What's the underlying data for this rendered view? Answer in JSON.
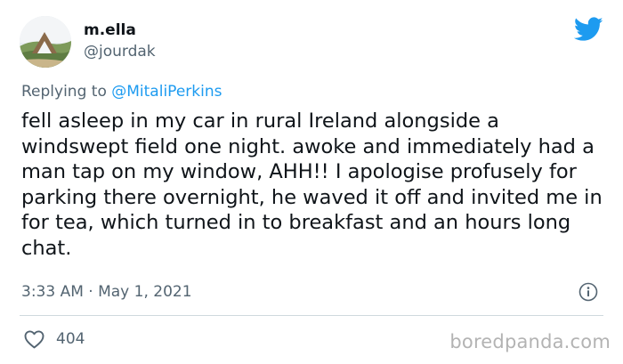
{
  "author": {
    "display_name": "m.ella",
    "handle": "@jourdak",
    "avatar_icon": "landscape-avatar"
  },
  "reply": {
    "prefix": "Replying to ",
    "mention": "@MitaliPerkins"
  },
  "tweet": {
    "text": "fell asleep in my car in rural Ireland alongside a windswept field one night. awoke and immediately had a man tap on my window, AHH!! I apologise profusely for parking there overnight, he waved it off and invited me in for tea, which turned in to breakfast and an hours long chat.",
    "timestamp": "3:33 AM · May 1, 2021"
  },
  "engagement": {
    "likes": "404"
  },
  "watermark": "boredpanda.com",
  "colors": {
    "twitter_blue": "#1d9bf0",
    "secondary_text": "#536471",
    "primary_text": "#0f1419"
  }
}
